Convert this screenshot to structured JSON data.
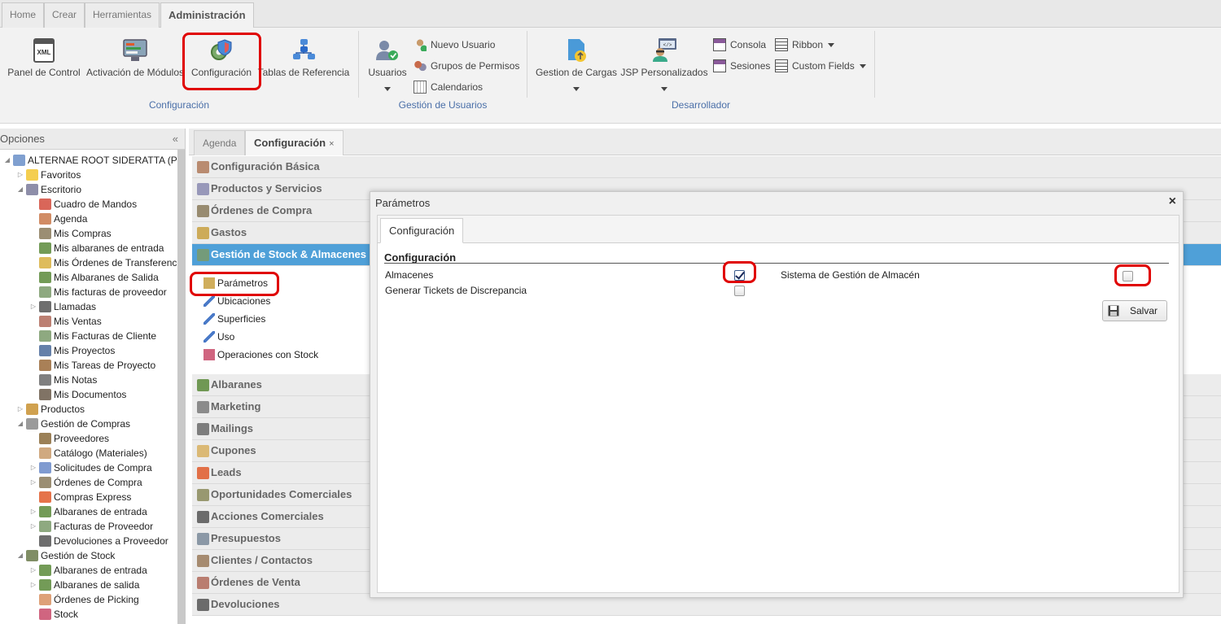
{
  "top_tabs": [
    {
      "label": "Home"
    },
    {
      "label": "Crear"
    },
    {
      "label": "Herramientas"
    },
    {
      "label": "Administración",
      "active": true
    }
  ],
  "ribbon": {
    "configuracion_group": {
      "label": "Configuración",
      "buttons": [
        {
          "label": "Panel de Control",
          "icon": "xml-document-icon"
        },
        {
          "label": "Activación de Módulos",
          "icon": "modules-icon"
        },
        {
          "label": "Configuración",
          "icon": "gear-shield-icon"
        },
        {
          "label": "Tablas de Referencia",
          "icon": "database-tables-icon"
        }
      ]
    },
    "usuarios_group": {
      "label": "Gestión de Usuarios",
      "usuarios_label": "Usuarios",
      "small_items": [
        {
          "label": "Nuevo Usuario",
          "icon": "new-user-icon"
        },
        {
          "label": "Grupos de Permisos",
          "icon": "permission-groups-icon"
        },
        {
          "label": "Calendarios",
          "icon": "calendar-icon"
        }
      ]
    },
    "desarrollador_group": {
      "label": "Desarrollador",
      "gestion_cargas_label": "Gestion de Cargas",
      "jsp_label": "JSP Personalizados",
      "small_items": [
        {
          "label": "Consola",
          "icon": "console-icon"
        },
        {
          "label": "Sesiones",
          "icon": "sessions-icon"
        },
        {
          "label": "Ribbon",
          "icon": "ribbon-icon"
        },
        {
          "label": "Custom Fields",
          "icon": "custom-fields-icon"
        }
      ]
    }
  },
  "sidebar": {
    "title": "Opciones",
    "collapse_glyph": "«",
    "tree": [
      {
        "label": "ALTERNAE ROOT SIDERATTA (PYE",
        "level": 0,
        "exp": "◢",
        "icon_color": "#6a8fc8"
      },
      {
        "label": "Favoritos",
        "level": 1,
        "exp": "▷",
        "icon_color": "#f2c531"
      },
      {
        "label": "Escritorio",
        "level": 1,
        "exp": "◢",
        "icon_color": "#7a7a9a"
      },
      {
        "label": "Cuadro de Mandos",
        "level": 2,
        "exp": "",
        "icon_color": "#d24b3c"
      },
      {
        "label": "Agenda",
        "level": 2,
        "exp": "",
        "icon_color": "#c9784a"
      },
      {
        "label": "Mis Compras",
        "level": 2,
        "exp": "",
        "icon_color": "#8a7a5a"
      },
      {
        "label": "Mis albaranes de entrada",
        "level": 2,
        "exp": "",
        "icon_color": "#5a8a3a"
      },
      {
        "label": "Mis Órdenes de Transferenci",
        "level": 2,
        "exp": "",
        "icon_color": "#d8b040"
      },
      {
        "label": "Mis Albaranes de Salida",
        "level": 2,
        "exp": "",
        "icon_color": "#5a8a3a"
      },
      {
        "label": "Mis facturas de proveedor",
        "level": 2,
        "exp": "",
        "icon_color": "#7a9a6a"
      },
      {
        "label": "Llamadas",
        "level": 2,
        "exp": "▷",
        "icon_color": "#555555"
      },
      {
        "label": "Mis Ventas",
        "level": 2,
        "exp": "",
        "icon_color": "#b06a5a"
      },
      {
        "label": "Mis Facturas de Cliente",
        "level": 2,
        "exp": "",
        "icon_color": "#7a9a6a"
      },
      {
        "label": "Mis Proyectos",
        "level": 2,
        "exp": "",
        "icon_color": "#4a6a9a"
      },
      {
        "label": "Mis Tareas de Proyecto",
        "level": 2,
        "exp": "",
        "icon_color": "#9a6a3a"
      },
      {
        "label": "Mis Notas",
        "level": 2,
        "exp": "",
        "icon_color": "#6a6a6a"
      },
      {
        "label": "Mis Documentos",
        "level": 2,
        "exp": "",
        "icon_color": "#6a5a4a"
      },
      {
        "label": "Productos",
        "level": 1,
        "exp": "▷",
        "icon_color": "#c89030"
      },
      {
        "label": "Gestión de Compras",
        "level": 1,
        "exp": "◢",
        "icon_color": "#8a8a8a"
      },
      {
        "label": "Proveedores",
        "level": 2,
        "exp": "",
        "icon_color": "#8a6a3a"
      },
      {
        "label": "Catálogo (Materiales)",
        "level": 2,
        "exp": "",
        "icon_color": "#c89a6a"
      },
      {
        "label": "Solicitudes de Compra",
        "level": 2,
        "exp": "▷",
        "icon_color": "#6a8ac8"
      },
      {
        "label": "Órdenes de Compra",
        "level": 2,
        "exp": "▷",
        "icon_color": "#8a7a5a"
      },
      {
        "label": "Compras Express",
        "level": 2,
        "exp": "",
        "icon_color": "#e05a2a"
      },
      {
        "label": "Albaranes de entrada",
        "level": 2,
        "exp": "▷",
        "icon_color": "#5a8a3a"
      },
      {
        "label": "Facturas de Proveedor",
        "level": 2,
        "exp": "▷",
        "icon_color": "#7a9a6a"
      },
      {
        "label": "Devoluciones a Proveedor",
        "level": 2,
        "exp": "",
        "icon_color": "#555555"
      },
      {
        "label": "Gestión de Stock",
        "level": 1,
        "exp": "◢",
        "icon_color": "#6a7a4a"
      },
      {
        "label": "Albaranes de entrada",
        "level": 2,
        "exp": "▷",
        "icon_color": "#5a8a3a"
      },
      {
        "label": "Albaranes de salida",
        "level": 2,
        "exp": "▷",
        "icon_color": "#5a8a3a"
      },
      {
        "label": "Órdenes de Picking",
        "level": 2,
        "exp": "",
        "icon_color": "#d89060"
      },
      {
        "label": "Stock",
        "level": 2,
        "exp": "",
        "icon_color": "#c84a6a"
      }
    ]
  },
  "doc_tabs": [
    {
      "label": "Agenda"
    },
    {
      "label": "Configuración",
      "close": "×",
      "active": true
    }
  ],
  "accordion": [
    {
      "label": "Configuración Básica",
      "icon_color": "#b07a5a"
    },
    {
      "label": "Productos y Servicios",
      "icon_color": "#8a8ab0"
    },
    {
      "label": "Órdenes de Compra",
      "icon_color": "#8a7a5a"
    },
    {
      "label": "Gastos",
      "icon_color": "#c8a040"
    },
    {
      "label": "Gestión de Stock & Almacenes",
      "icon_color": "#7a9a6a",
      "active": true
    },
    {
      "label": "Albaranes",
      "icon_color": "#5a8a3a"
    },
    {
      "label": "Marketing",
      "icon_color": "#7a7a7a"
    },
    {
      "label": "Mailings",
      "icon_color": "#6a6a6a"
    },
    {
      "label": "Cupones",
      "icon_color": "#d8b060"
    },
    {
      "label": "Leads",
      "icon_color": "#e05a2a"
    },
    {
      "label": "Oportunidades Comerciales",
      "icon_color": "#8a8a5a"
    },
    {
      "label": "Acciones Comerciales",
      "icon_color": "#555555"
    },
    {
      "label": "Presupuestos",
      "icon_color": "#7a8a9a"
    },
    {
      "label": "Clientes / Contactos",
      "icon_color": "#9a7a5a"
    },
    {
      "label": "Órdenes de Venta",
      "icon_color": "#b06a5a"
    },
    {
      "label": "Devoluciones",
      "icon_color": "#555555"
    }
  ],
  "stock_subitems": [
    {
      "label": "Parámetros",
      "icon": "parameters-icon",
      "color": "#c8a040"
    },
    {
      "label": "Ubicaciones",
      "icon": "pin-icon",
      "color": "#4a7ac8"
    },
    {
      "label": "Superficies",
      "icon": "pin-icon",
      "color": "#4a7ac8"
    },
    {
      "label": "Uso",
      "icon": "pin-icon",
      "color": "#4a7ac8"
    },
    {
      "label": "Operaciones con Stock",
      "icon": "stock-operations-icon",
      "color": "#c84a6a"
    }
  ],
  "modal": {
    "title": "Parámetros",
    "close": "×",
    "tab": "Configuración",
    "section_title": "Configuración",
    "fields": [
      {
        "label": "Almacenes",
        "checked": true
      },
      {
        "label": "Generar Tickets de Discrepancia",
        "checked": false
      },
      {
        "label": "Sistema de Gestión de Almacén",
        "checked": false
      }
    ],
    "save_label": "Salvar"
  }
}
